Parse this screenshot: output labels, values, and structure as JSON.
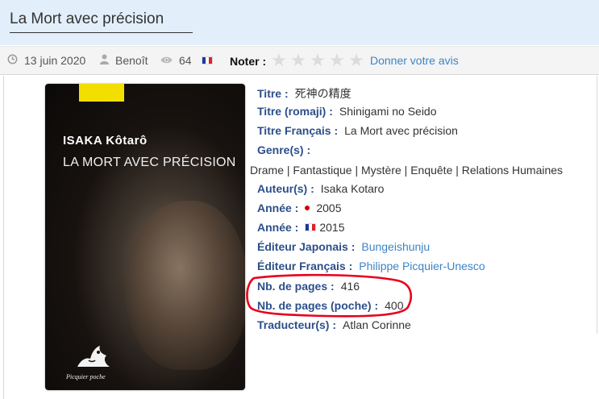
{
  "header": {
    "title": "La Mort avec précision"
  },
  "meta": {
    "date": "13 juin 2020",
    "author": "Benoît",
    "views": "64",
    "flag_colors": [
      "#1a3b9c",
      "#ffffff",
      "#e0202a"
    ],
    "note_label": "Noter :",
    "rating_stars": 5,
    "rating_value": 0,
    "rate_link": "Donner votre avis",
    "icons": [
      "clock-icon",
      "user-icon",
      "eye-icon",
      "flag-fr-icon",
      "star-icon"
    ]
  },
  "cover": {
    "author": "ISAKA Kôtarô",
    "title": "LA MORT AVEC PRÉCISION",
    "publisher": "Picquier poche"
  },
  "book": {
    "titre": {
      "label": "Titre :",
      "value": "死神の精度"
    },
    "titre_romaji": {
      "label": "Titre (romaji) :",
      "value": "Shinigami no Seido"
    },
    "titre_fr": {
      "label": "Titre Français :",
      "value": "La Mort avec précision"
    },
    "genres": {
      "label": "Genre(s) :",
      "value": "Drame | Fantastique | Mystère | Enquête | Relations Humaines"
    },
    "auteurs": {
      "label": "Auteur(s) :",
      "value": "Isaka Kotaro"
    },
    "annee_jp": {
      "label": "Année :",
      "value": "2005"
    },
    "annee_fr": {
      "label": "Année :",
      "value": "2015"
    },
    "editeur_jp": {
      "label": "Éditeur Japonais :",
      "value": "Bungeishunju"
    },
    "editeur_fr": {
      "label": "Éditeur Français :",
      "value": "Philippe Picquier-Unesco"
    },
    "pages": {
      "label": "Nb. de pages :",
      "value": "416"
    },
    "pages_poche": {
      "label": "Nb. de pages (poche) :",
      "value": "400"
    },
    "traducteur": {
      "label": "Traducteur(s) :",
      "value": "Atlan Corinne"
    }
  },
  "colors": {
    "header_bg": "#e2eef9",
    "label": "#2c4f8a",
    "link": "#3d84c7",
    "highlight": "#e8001c"
  }
}
